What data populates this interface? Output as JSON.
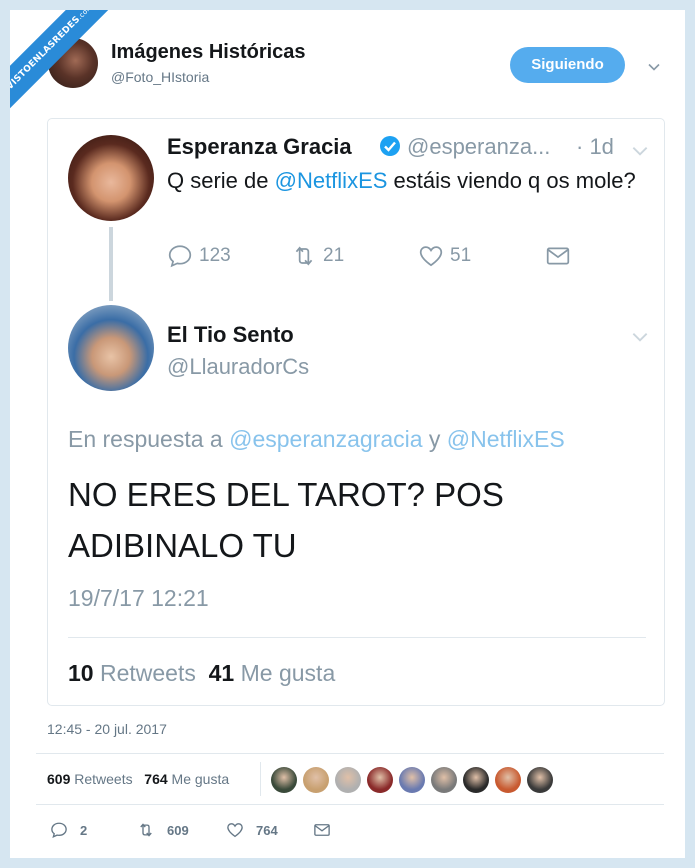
{
  "watermark": {
    "text": "VISTOENLASREDES",
    "suffix": ".com",
    "color": "#2a8bd8"
  },
  "header": {
    "name": "Imágenes Históricas",
    "handle": "@Foto_HIstoria",
    "follow_label": "Siguiendo",
    "accent": "#55acee"
  },
  "quoted_tweet": {
    "author": {
      "name": "Esperanza Gracia",
      "handle": "@esperanza...",
      "time": "· 1d",
      "verified": true
    },
    "text_prefix": "Q serie de ",
    "text_mention": "@NetflixES",
    "text_suffix": " estáis viendo q os mole?",
    "actions": {
      "replies": "123",
      "retweets": "21",
      "likes": "51"
    },
    "reply": {
      "name": "El Tio Sento",
      "handle": "@LlauradorCs",
      "reply_prefix": "En respuesta a ",
      "reply_mention1": "@esperanzagracia",
      "reply_and": " y ",
      "reply_mention2": "@NetflixES",
      "text_line1": "NO ERES DEL TAROT? POS",
      "text_line2": "ADIBINALO TU",
      "timestamp": "19/7/17 12:21",
      "retweets_count": "10",
      "retweets_label": "Retweets",
      "likes_count": "41",
      "likes_label": "Me gusta"
    }
  },
  "timestamp": "12:45 - 20 jul. 2017",
  "stats": {
    "retweets_count": "609",
    "retweets_label": "Retweets",
    "likes_count": "764",
    "likes_label": "Me gusta"
  },
  "liker_avatars": [
    "#3a4a3a",
    "#c8a070",
    "#b0b0b0",
    "#8a2a2a",
    "#6a7ab0",
    "#7a7a7a",
    "#2a2a2a",
    "#c85a30",
    "#3a3a3a"
  ],
  "bottom_actions": {
    "replies": "2",
    "retweets": "609",
    "likes": "764"
  }
}
